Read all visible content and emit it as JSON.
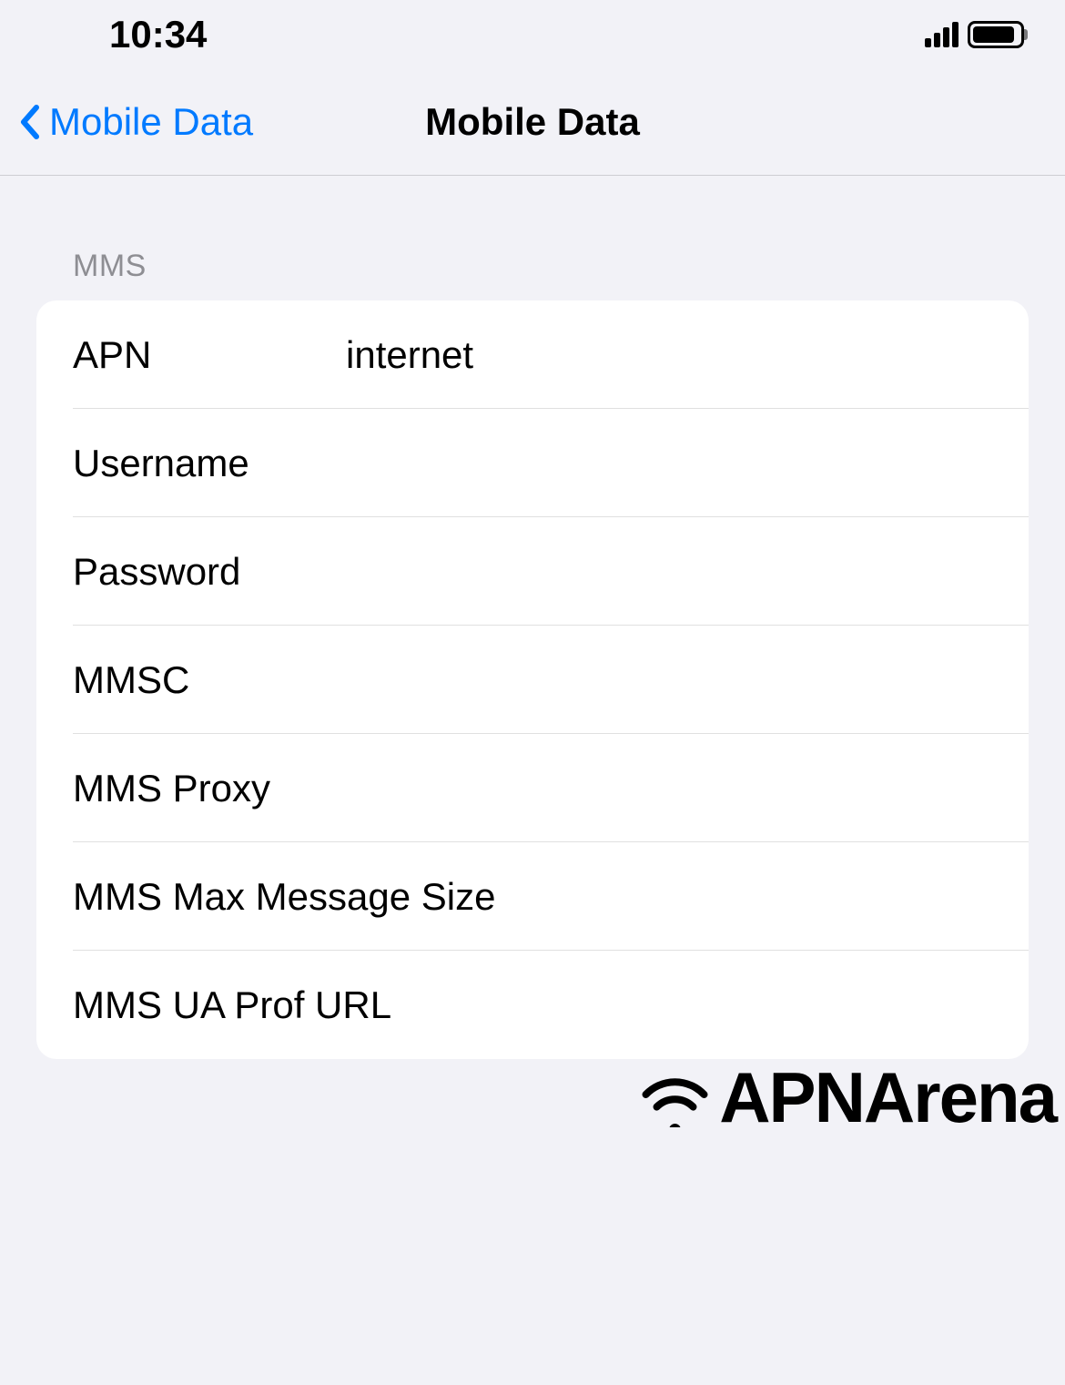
{
  "status_bar": {
    "time": "10:34"
  },
  "nav": {
    "back_label": "Mobile Data",
    "title": "Mobile Data"
  },
  "section": {
    "header": "MMS",
    "rows": {
      "apn": {
        "label": "APN",
        "value": "internet"
      },
      "username": {
        "label": "Username",
        "value": ""
      },
      "password": {
        "label": "Password",
        "value": ""
      },
      "mmsc": {
        "label": "MMSC",
        "value": ""
      },
      "mms_proxy": {
        "label": "MMS Proxy",
        "value": ""
      },
      "mms_max": {
        "label": "MMS Max Message Size",
        "value": ""
      },
      "mms_ua": {
        "label": "MMS UA Prof URL",
        "value": ""
      }
    }
  },
  "watermark": {
    "text": "APNArena"
  }
}
